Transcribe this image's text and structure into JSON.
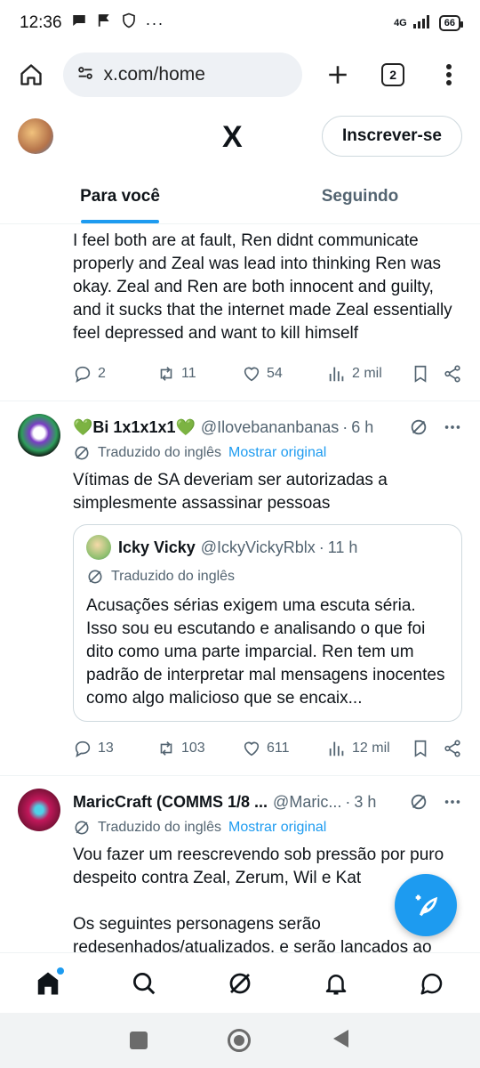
{
  "status_bar": {
    "time": "12:36",
    "network": "4G",
    "battery": "66",
    "more": "···"
  },
  "browser": {
    "url": "x.com/home",
    "tab_count": "2"
  },
  "x_header": {
    "logo": "X",
    "subscribe_label": "Inscrever-se"
  },
  "tabs": [
    {
      "label": "Para você",
      "active": true
    },
    {
      "label": "Seguindo",
      "active": false
    }
  ],
  "posts": [
    {
      "text": "I feel both are at fault, Ren didnt communicate properly and Zeal was lead into thinking Ren was okay. Zeal and Ren are both innocent and guilty, and it sucks that the internet made Zeal essentially feel depressed and want to kill himself",
      "replies": "2",
      "reposts": "11",
      "likes": "54",
      "views": "2 mil"
    },
    {
      "display_name": "💚Bi 1x1x1x1💚",
      "handle": "@Ilovebananbanas",
      "time": "6 h",
      "translated_label": "Traduzido do inglês",
      "show_original": "Mostrar original",
      "text": "Vítimas de SA deveriam ser autorizadas a simplesmente assassinar pessoas",
      "quote": {
        "display_name": "Icky Vicky",
        "handle": "@IckyVickyRblx",
        "time": "11 h",
        "translated_label": "Traduzido do inglês",
        "text": "Acusações sérias exigem uma escuta séria. Isso sou eu escutando e analisando o que foi dito como uma parte imparcial. Ren tem um padrão de interpretar mal mensagens inocentes como algo malicioso que se encaix..."
      },
      "replies": "13",
      "reposts": "103",
      "likes": "611",
      "views": "12 mil"
    },
    {
      "display_name": "MaricCraft (COMMS 1/8 ...",
      "handle": "@Maric...",
      "time": "3 h",
      "translated_label": "Traduzido do inglês",
      "show_original": "Mostrar original",
      "text": "Vou fazer um reescrevendo sob pressão por puro despeito contra Zeal, Zerum, Wil e Kat\n\nOs seguintes personagens serão redesenhados/atualizados, e serão lançados ao longo do tempo:"
    }
  ],
  "colors": {
    "accent": "#1d9bf0",
    "secondary_text": "#536471",
    "border": "#eff3f4"
  },
  "bottom_nav": [
    "home-icon",
    "search-icon",
    "grok-icon",
    "notifications-icon",
    "messages-icon"
  ],
  "system_nav": [
    "recents-icon",
    "home-circle-icon",
    "back-icon"
  ]
}
